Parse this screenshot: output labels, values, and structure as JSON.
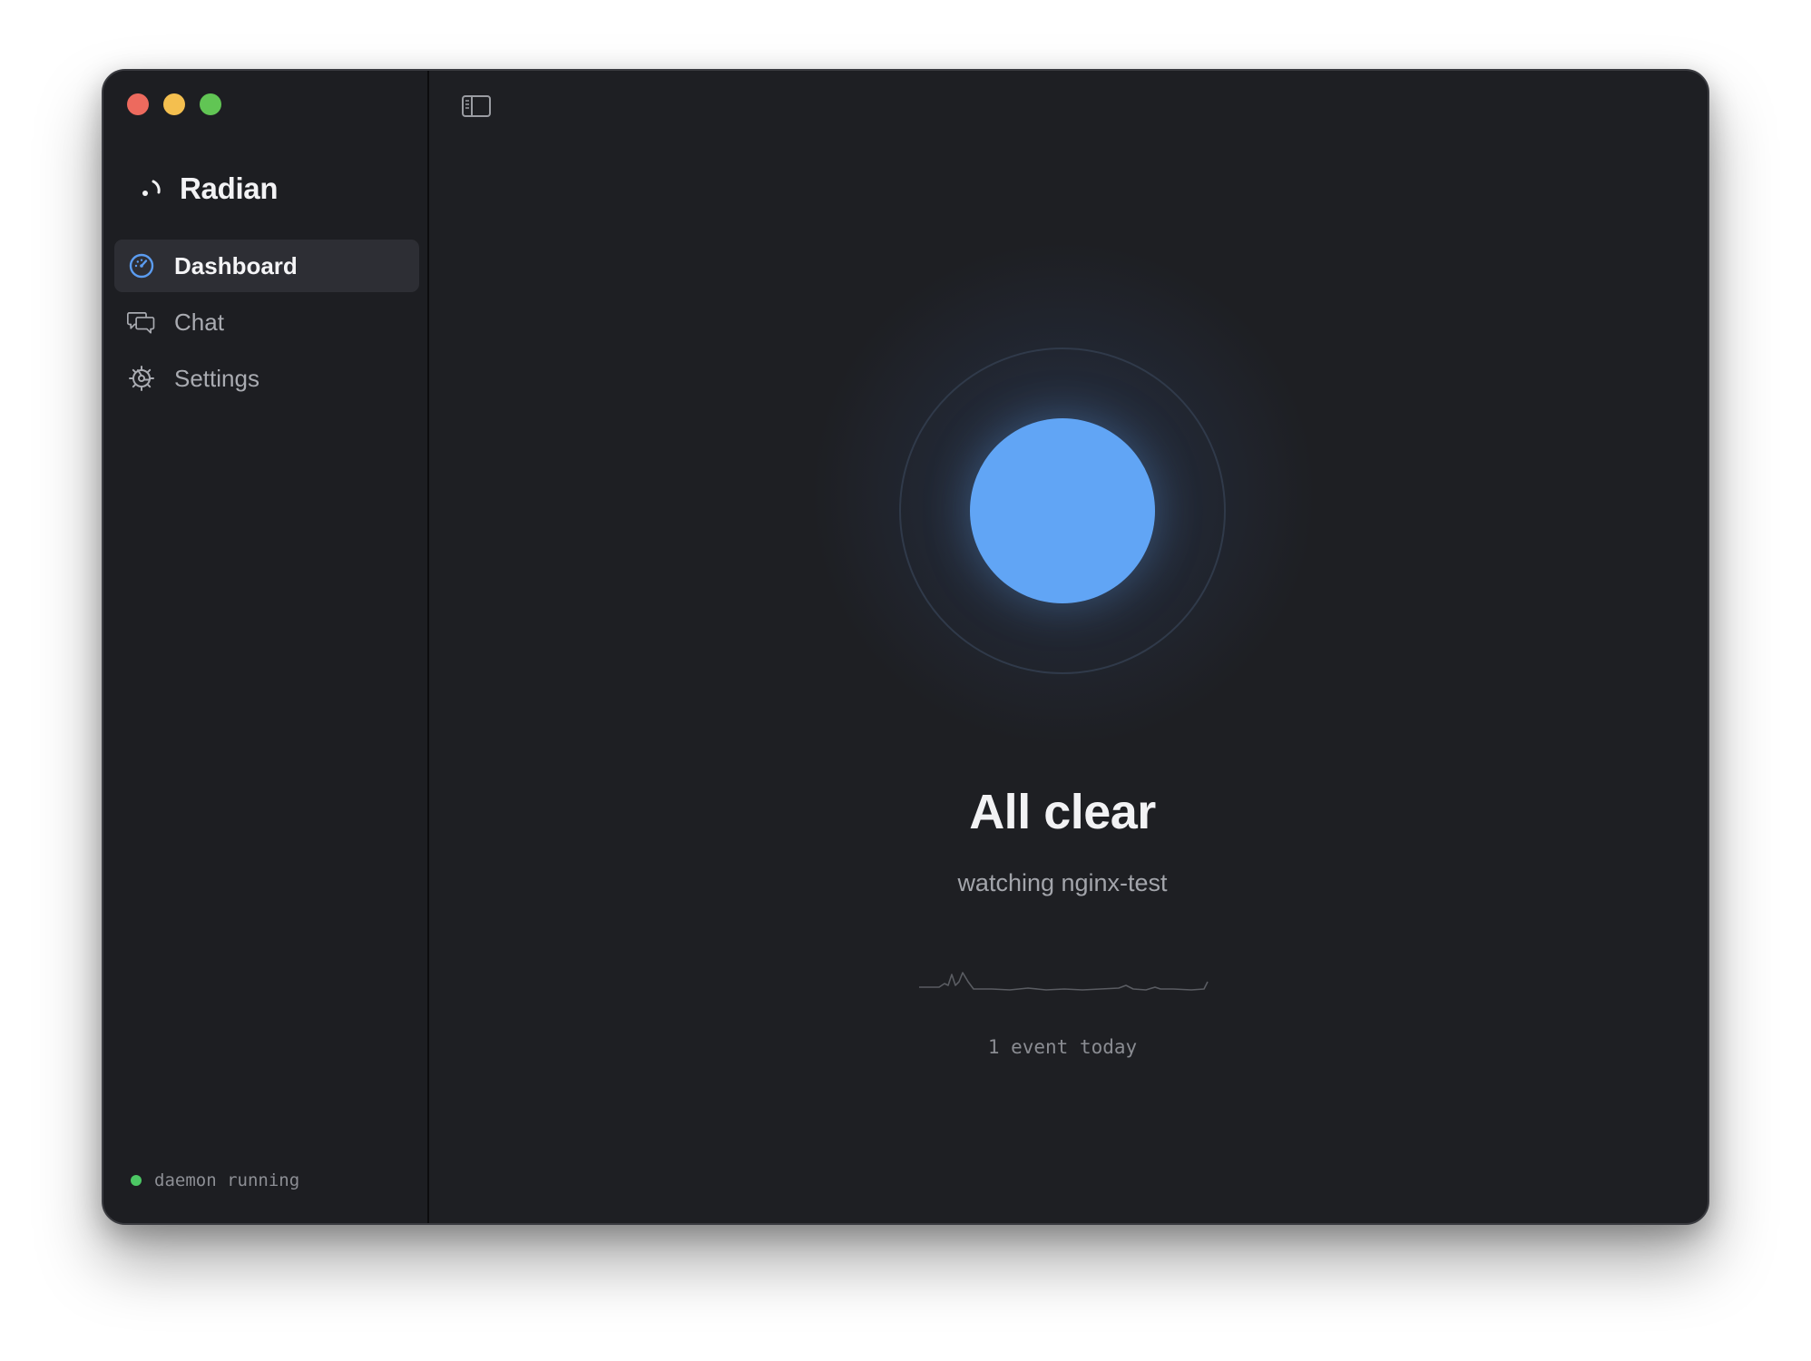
{
  "app": {
    "name": "Radian",
    "logo_icon": "radian-logo-icon"
  },
  "sidebar": {
    "items": [
      {
        "label": "Dashboard",
        "icon": "gauge-icon",
        "active": true
      },
      {
        "label": "Chat",
        "icon": "chat-bubbles-icon",
        "active": false
      },
      {
        "label": "Settings",
        "icon": "gear-icon",
        "active": false
      }
    ],
    "status": {
      "text": "daemon running",
      "color": "#4cc764"
    }
  },
  "toolbar": {
    "toggle_icon": "sidebar-toggle-icon"
  },
  "dashboard": {
    "title": "All clear",
    "subtitle": "watching nginx-test",
    "events_text": "1 event today",
    "orb_color": "#61a5f5"
  },
  "colors": {
    "background": "#1e1f23",
    "accent": "#61a5f5",
    "ok": "#4cc764"
  }
}
